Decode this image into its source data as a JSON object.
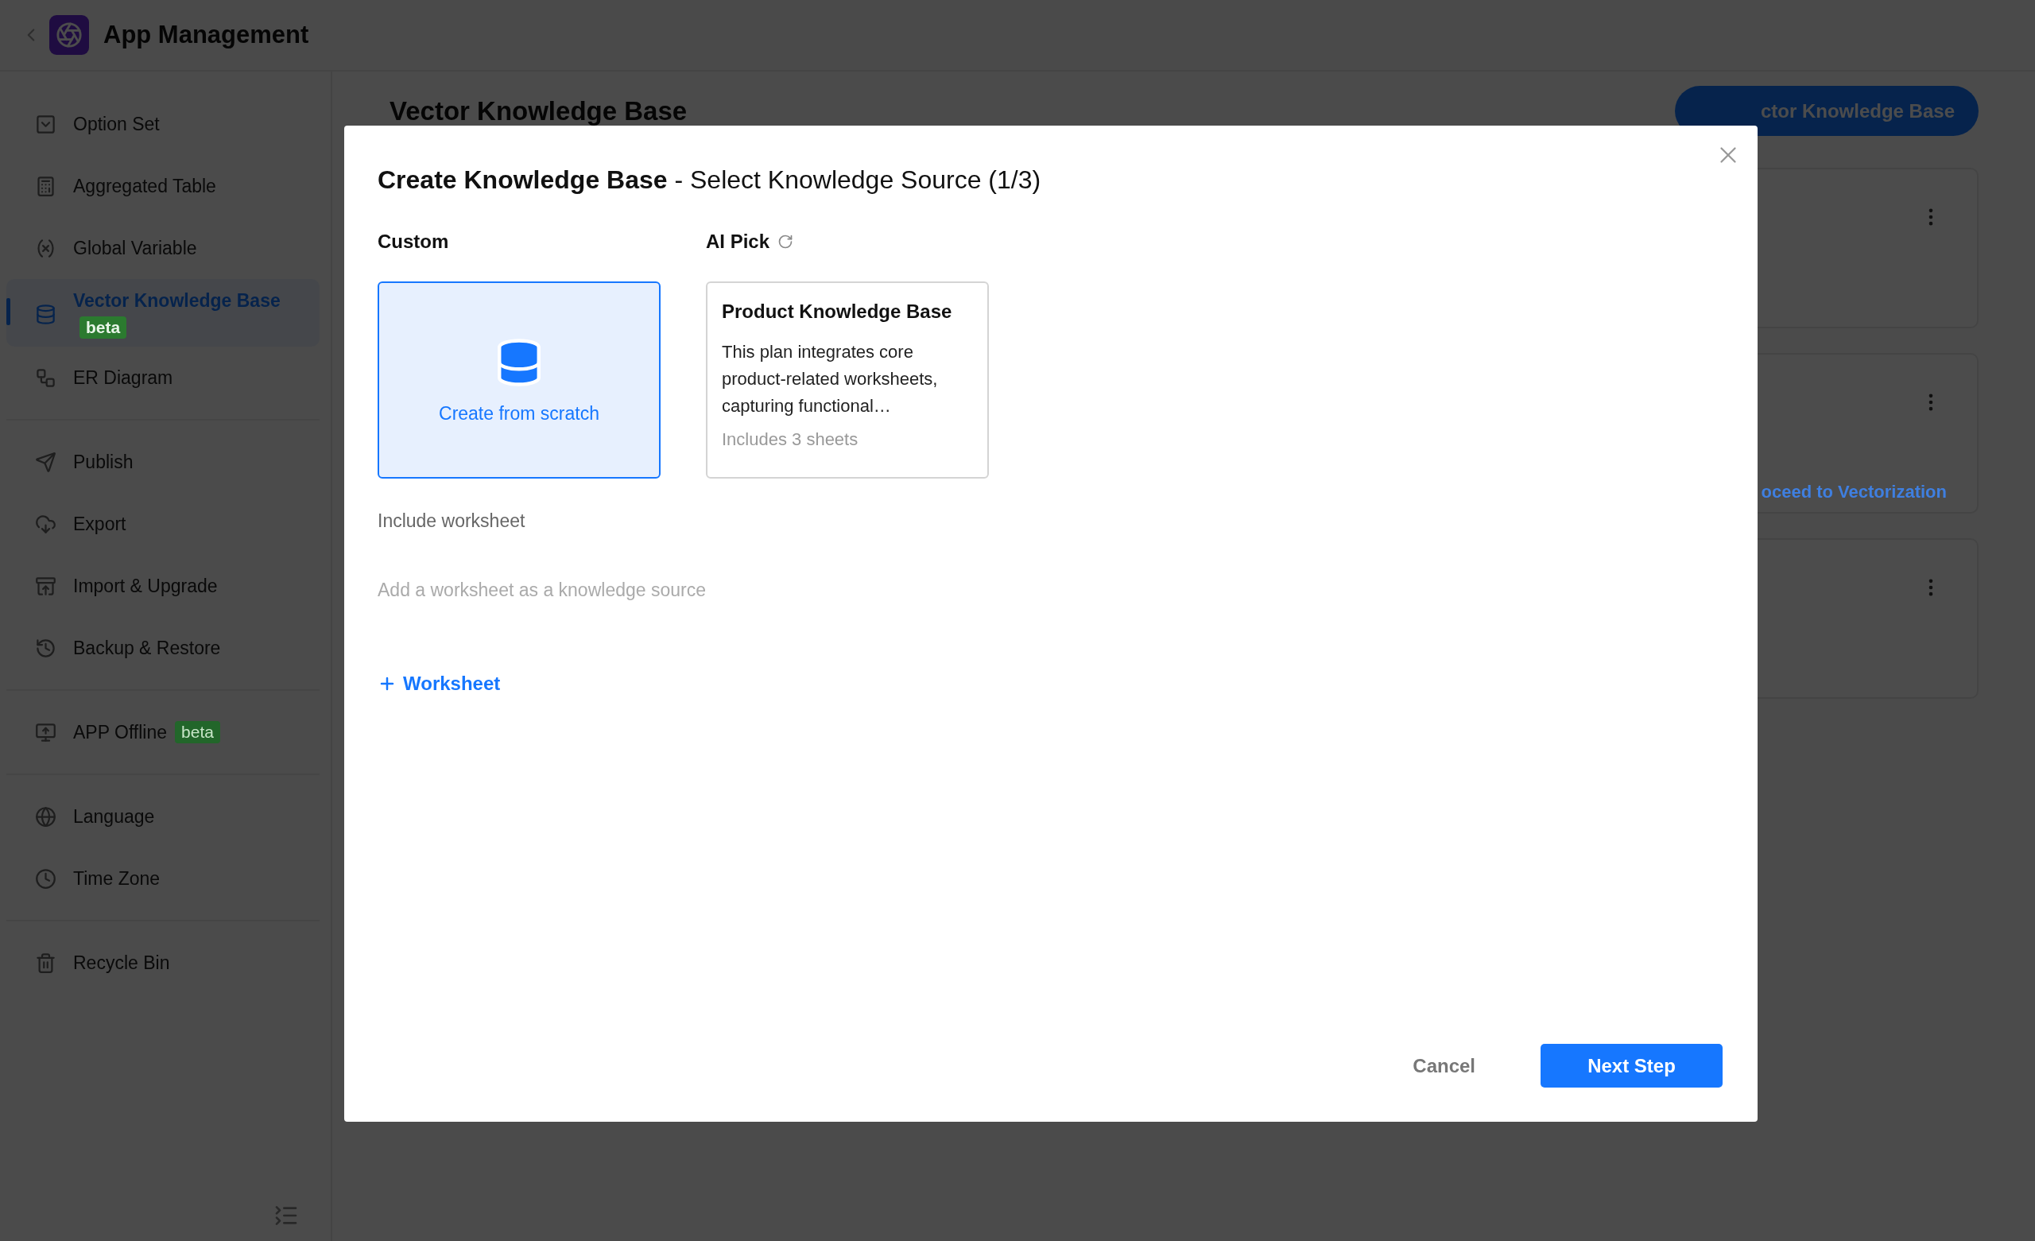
{
  "header": {
    "title": "App Management"
  },
  "sidebar": {
    "groups": [
      {
        "items": [
          {
            "label": "Option Set",
            "selected": false
          },
          {
            "label": "Aggregated Table",
            "selected": false
          },
          {
            "label": "Global Variable",
            "selected": false
          },
          {
            "label": "Vector Knowledge Base",
            "badge": "beta",
            "selected": true
          },
          {
            "label": "ER Diagram",
            "selected": false
          }
        ]
      },
      {
        "items": [
          {
            "label": "Publish",
            "selected": false
          },
          {
            "label": "Export",
            "selected": false
          },
          {
            "label": "Import & Upgrade",
            "selected": false
          },
          {
            "label": "Backup & Restore",
            "selected": false
          }
        ]
      },
      {
        "items": [
          {
            "label": "APP Offline",
            "badge": "beta",
            "selected": false
          }
        ]
      },
      {
        "items": [
          {
            "label": "Language",
            "selected": false
          },
          {
            "label": "Time Zone",
            "selected": false
          }
        ]
      },
      {
        "items": [
          {
            "label": "Recycle Bin",
            "selected": false
          }
        ]
      }
    ]
  },
  "page": {
    "title": "Vector Knowledge Base",
    "add_button": "ctor Knowledge Base",
    "cards": [
      {
        "kind": "plain"
      },
      {
        "kind": "link",
        "link": "oceed to Vectorization"
      },
      {
        "kind": "plain"
      }
    ]
  },
  "modal": {
    "title": "**Create Knowledge Base** - Select Knowledge Source (1/3)",
    "columns": [
      {
        "heading": "Custom",
        "refresh": false,
        "option": {
          "kind": "scratch",
          "label": "Create from scratch",
          "selected": true
        }
      },
      {
        "heading": "AI Pick",
        "refresh": true,
        "option": {
          "kind": "plan",
          "title": "Product Knowledge Base",
          "description": "This plan integrates core product-related worksheets, capturing functional…",
          "note": "Includes 3 sheets",
          "selected": false
        }
      }
    ],
    "worksheet": {
      "label": "Include worksheet",
      "hint": "Add a worksheet as a knowledge source",
      "add_button": "Worksheet"
    },
    "buttons": {
      "cancel": "Cancel",
      "next": "Next Step"
    }
  }
}
